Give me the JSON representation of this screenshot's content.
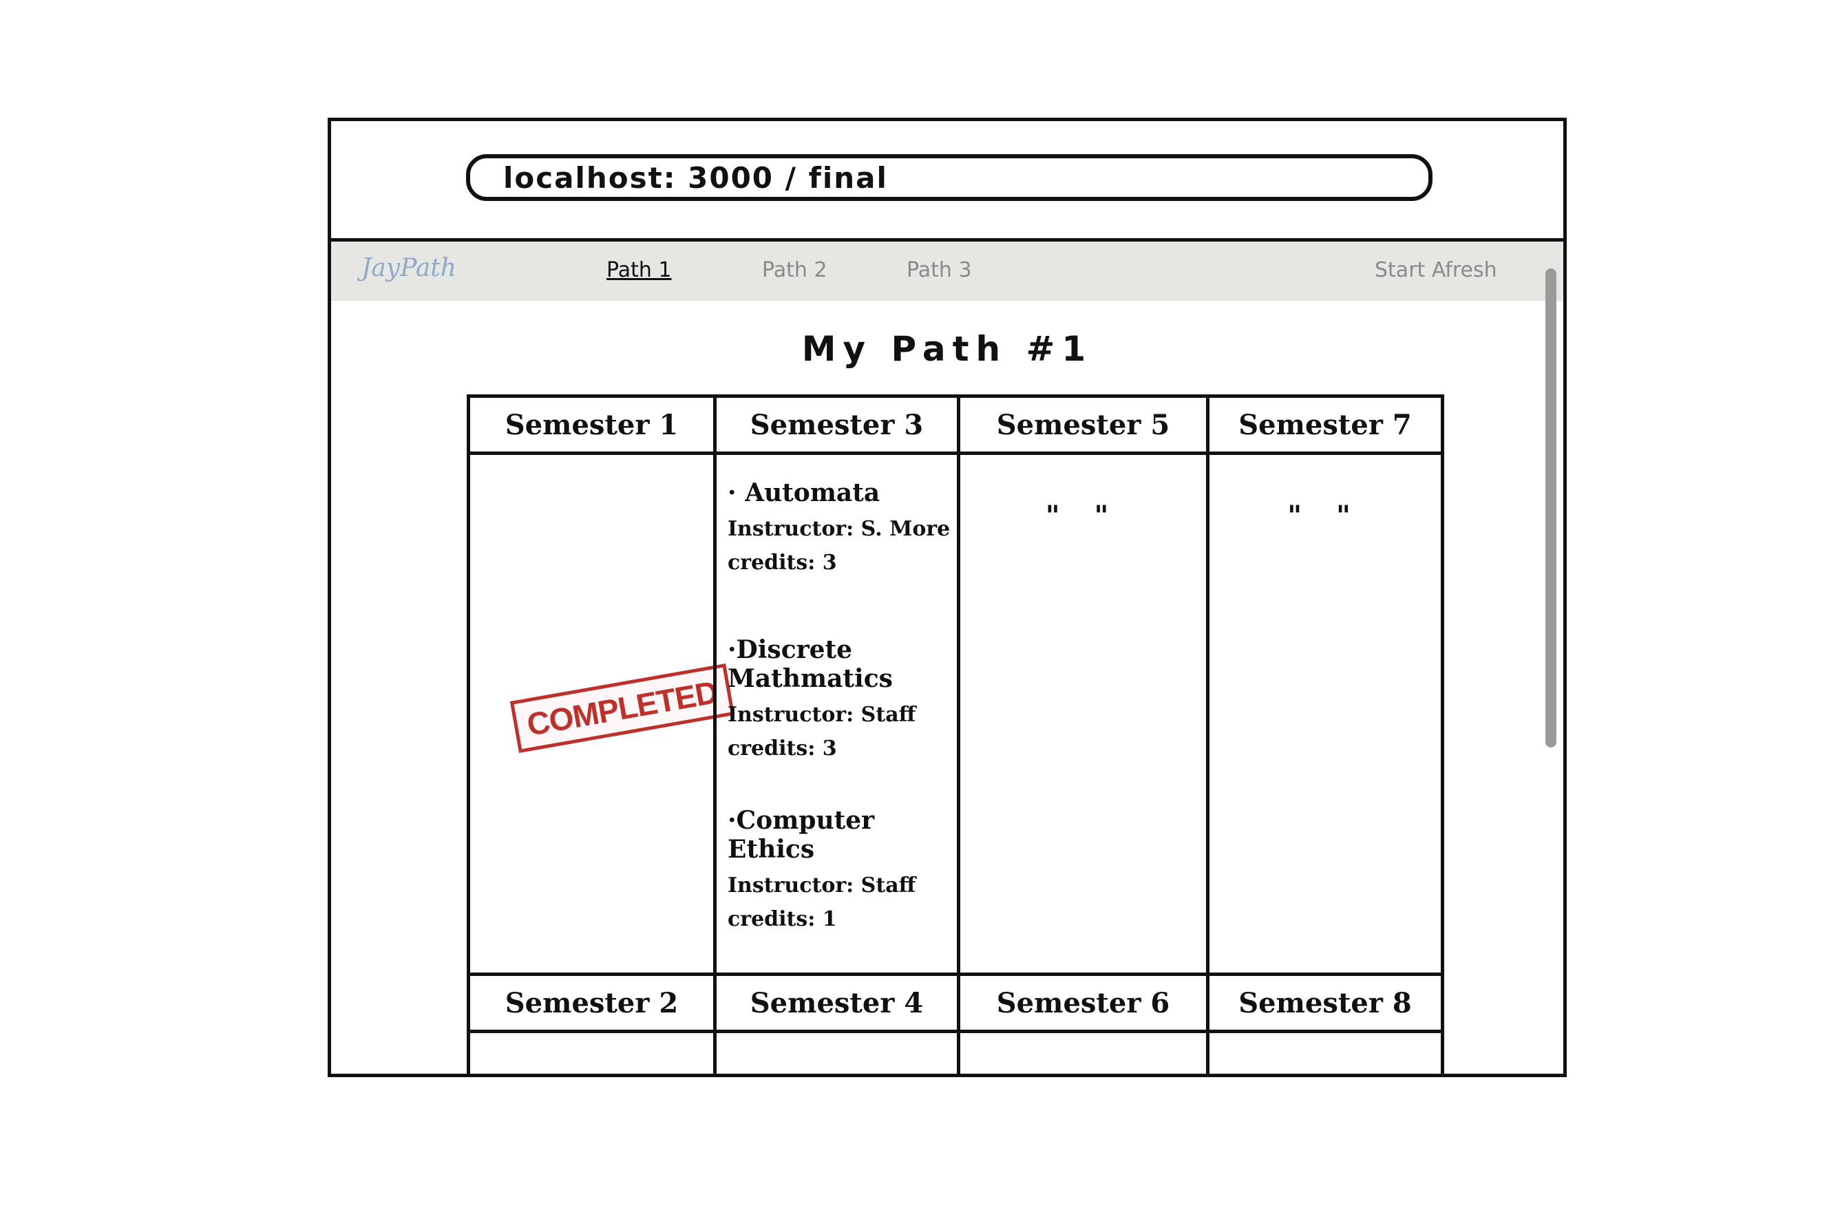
{
  "browser": {
    "url": "localhost: 3000 / final"
  },
  "nav": {
    "brand": "JayPath",
    "links": [
      "Path 1",
      "Path 2",
      "Path 3"
    ],
    "start_afresh": "Start Afresh"
  },
  "page": {
    "title": "My Path #1"
  },
  "semesters": {
    "top": [
      {
        "label": "Semester 1",
        "stamp": "COMPLETED"
      },
      {
        "label": "Semester 3",
        "courses": [
          {
            "name": "· Automata",
            "instructor": "Instructor: S. More",
            "credits": "credits: 3"
          },
          {
            "name": "·Discrete Mathmatics",
            "instructor": "Instructor: Staff",
            "credits": "credits: 3"
          },
          {
            "name": "·Computer Ethics",
            "instructor": "Instructor: Staff",
            "credits": "credits: 1"
          }
        ]
      },
      {
        "label": "Semester 5",
        "ditto": "\" \""
      },
      {
        "label": "Semester 7",
        "ditto": "\" \""
      }
    ],
    "bottom": [
      {
        "label": "Semester 2"
      },
      {
        "label": "Semester 4"
      },
      {
        "label": "Semester 6"
      },
      {
        "label": "Semester 8"
      }
    ]
  }
}
